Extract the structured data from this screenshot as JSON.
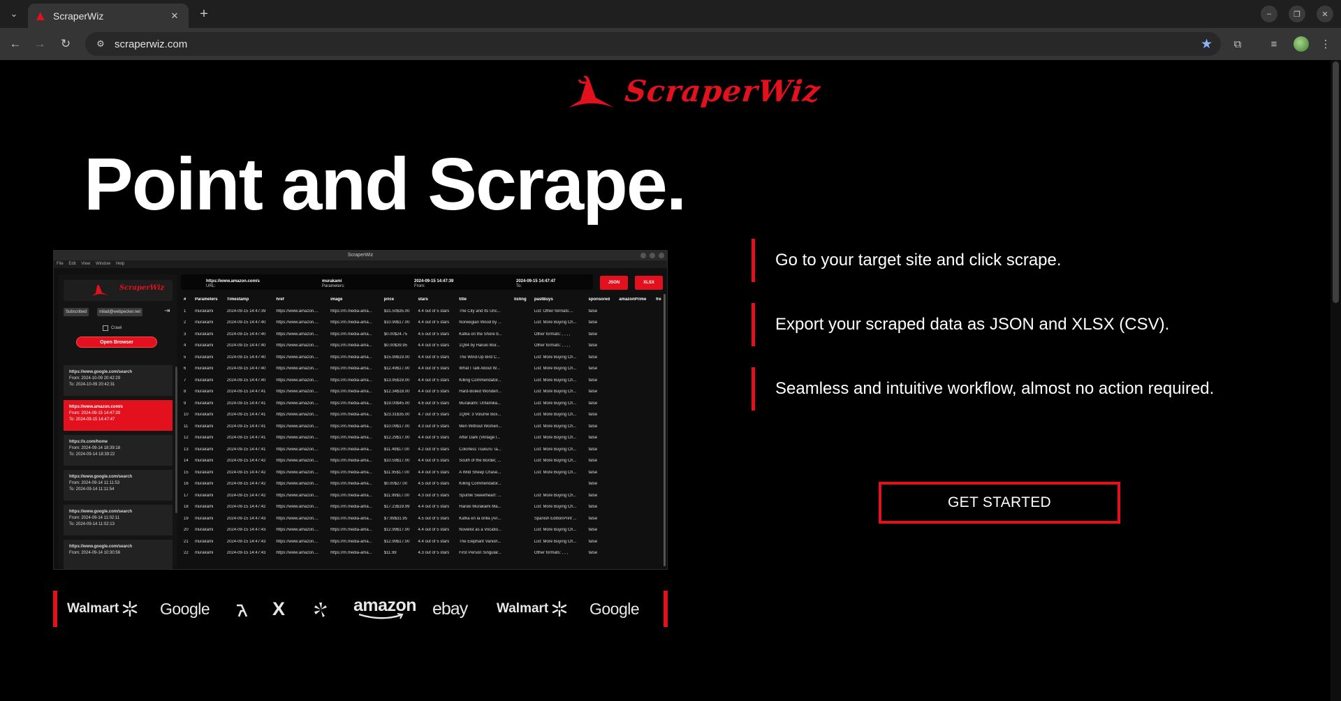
{
  "browser": {
    "tab_title": "ScraperWiz",
    "url": "scraperwiz.com"
  },
  "brand": {
    "name": "ScraperWiz"
  },
  "hero": {
    "title": "Point and Scrape."
  },
  "features": [
    {
      "text": "Go to your target site and click scrape."
    },
    {
      "text": "Export your scraped data as JSON and XLSX (CSV)."
    },
    {
      "text": "Seamless and intuitive workflow, almost no action required."
    }
  ],
  "cta": {
    "label": "GET STARTED"
  },
  "preview": {
    "window_title": "ScraperWiz",
    "menu": [
      "File",
      "Edit",
      "View",
      "Window",
      "Help"
    ],
    "logo_name": "ScraperWiz",
    "subscribed": "Subscribed",
    "email": "milad@webpecker.net",
    "crawl": "Crawl",
    "open_browser": "Open Browser",
    "history": [
      {
        "url": "https://www.google.com/search",
        "from": "From: 2024-10-09 20:42:29",
        "to": "To: 2024-10-09 20:42:31"
      },
      {
        "url": "https://www.amazon.com/s",
        "from": "From: 2024-09-15 14:47:39",
        "to": "To: 2024-09-15 14:47:47"
      },
      {
        "url": "https://x.com/home",
        "from": "From: 2024-09-14 18:39:18",
        "to": "To: 2024-09-14 18:39:22"
      },
      {
        "url": "https://www.google.com/search",
        "from": "From: 2024-09-14 11:11:53",
        "to": "To: 2024-09-14 11:11:54"
      },
      {
        "url": "https://www.google.com/search",
        "from": "From: 2024-09-14 11:02:11",
        "to": "To: 2024-09-14 11:02:13"
      },
      {
        "url": "https://www.google.com/search",
        "from": "From: 2024-09-14 10:30:56",
        "to": ""
      }
    ],
    "params": {
      "url_label": "URL:",
      "url": "https://www.amazon.com/s",
      "parameters_label": "Parameters:",
      "parameters": "murakami",
      "from_label": "From:",
      "from": "2024-09-15 14:47:39",
      "to_label": "To:",
      "to": "2024-09-15 14:47:47"
    },
    "json_button": "JSON",
    "xlsx_button": "XLSX",
    "columns": [
      "#",
      "Parameters",
      "Timestamp",
      "href",
      "image",
      "price",
      "stars",
      "title",
      "listing",
      "pastBuys",
      "sponsored",
      "amazonPrime",
      "fre"
    ],
    "rows": [
      [
        "1",
        "murakami",
        "2024-09-15 14:47:39",
        "https://www.amazon....",
        "https://m.media-ama...",
        "$31.50$35.00",
        "4.4 out of 5 stars",
        "The City and Its Unc...",
        "",
        "List: Other formats:...",
        "false",
        "",
        ""
      ],
      [
        "2",
        "murakami",
        "2024-09-15 14:47:40",
        "https://www.amazon....",
        "https://m.media-ama...",
        "$10.99$17.00",
        "4.4 out of 5 stars",
        "Norwegian Wood by ...",
        "",
        "List: More Buying Ch...",
        "false",
        "",
        ""
      ],
      [
        "3",
        "murakami",
        "2024-09-15 14:47:40",
        "https://www.amazon....",
        "https://m.media-ama...",
        "$0.00$24.75",
        "4.5 out of 5 stars",
        "Kafka on the Shore b...",
        "",
        "Other formats: , , , ,",
        "false",
        "",
        ""
      ],
      [
        "4",
        "murakami",
        "2024-09-15 14:47:40",
        "https://www.amazon....",
        "https://m.media-ama...",
        "$0.00$39.95",
        "4.4 out of 5 stars",
        "1Q84 by Haruki Mur...",
        "",
        "Other formats: , , , ,",
        "false",
        "",
        ""
      ],
      [
        "5",
        "murakami",
        "2024-09-15 14:47:40",
        "https://www.amazon....",
        "https://m.media-ama...",
        "$15.99$19.00",
        "4.4 out of 5 stars",
        "The Wind-Up Bird C...",
        "",
        "List: More Buying Ch...",
        "false",
        "",
        ""
      ],
      [
        "6",
        "murakami",
        "2024-09-15 14:47:40",
        "https://www.amazon....",
        "https://m.media-ama...",
        "$12.49$17.00",
        "4.4 out of 5 stars",
        "What I Talk About W...",
        "",
        "List: More Buying Ch...",
        "false",
        "",
        ""
      ],
      [
        "7",
        "murakami",
        "2024-09-15 14:47:40",
        "https://www.amazon....",
        "https://m.media-ama...",
        "$13.95$19.00",
        "4.4 out of 5 stars",
        "Killing Commendator...",
        "",
        "List: More Buying Ch...",
        "false",
        "",
        ""
      ],
      [
        "8",
        "murakami",
        "2024-09-15 14:47:41",
        "https://www.amazon....",
        "https://m.media-ama...",
        "$12.34$18.00",
        "4.4 out of 5 stars",
        "Hard-Boiled Wonderl...",
        "",
        "List: More Buying Ch...",
        "false",
        "",
        ""
      ],
      [
        "9",
        "murakami",
        "2024-09-15 14:47:41",
        "https://www.amazon....",
        "https://m.media-ama...",
        "$19.00$45.00",
        "4.6 out of 5 stars",
        "Murakami: Unfamilia...",
        "",
        "List: More Buying Ch...",
        "false",
        "",
        ""
      ],
      [
        "10",
        "murakami",
        "2024-09-15 14:47:41",
        "https://www.amazon....",
        "https://m.media-ama...",
        "$23.31$35.00",
        "4.7 out of 5 stars",
        "1Q84: 3 Volume Box...",
        "",
        "List: More Buying Ch...",
        "false",
        "",
        ""
      ],
      [
        "11",
        "murakami",
        "2024-09-15 14:47:41",
        "https://www.amazon....",
        "https://m.media-ama...",
        "$10.09$17.00",
        "4.3 out of 5 stars",
        "Men Without Women...",
        "",
        "List: More Buying Ch...",
        "false",
        "",
        ""
      ],
      [
        "12",
        "murakami",
        "2024-09-15 14:47:41",
        "https://www.amazon....",
        "https://m.media-ama...",
        "$12.29$17.00",
        "4.4 out of 5 stars",
        "After Dark (Vintage I...",
        "",
        "List: More Buying Ch...",
        "false",
        "",
        ""
      ],
      [
        "13",
        "murakami",
        "2024-09-15 14:47:41",
        "https://www.amazon....",
        "https://m.media-ama...",
        "$11.49$17.00",
        "4.2 out of 5 stars",
        "Colorless Tsukuru Ta...",
        "",
        "List: More Buying Ch...",
        "false",
        "",
        ""
      ],
      [
        "14",
        "murakami",
        "2024-09-15 14:47:42",
        "https://www.amazon....",
        "https://m.media-ama...",
        "$10.59$17.00",
        "4.4 out of 5 stars",
        "South of the Border, ...",
        "",
        "List: More Buying Ch...",
        "false",
        "",
        ""
      ],
      [
        "15",
        "murakami",
        "2024-09-15 14:47:42",
        "https://www.amazon....",
        "https://m.media-ama...",
        "$11.95$17.00",
        "4.4 out of 5 stars",
        "A Wild Sheep Chase...",
        "",
        "List: More Buying Ch...",
        "false",
        "",
        ""
      ],
      [
        "16",
        "murakami",
        "2024-09-15 14:47:42",
        "https://www.amazon....",
        "https://m.media-ama...",
        "$0.00$27.00",
        "4.5 out of 5 stars",
        "Killing Commendator...",
        "",
        "",
        "false",
        "",
        ""
      ],
      [
        "17",
        "murakami",
        "2024-09-15 14:47:42",
        "https://www.amazon....",
        "https://m.media-ama...",
        "$11.99$17.00",
        "4.3 out of 5 stars",
        "Sputnik Sweetheart: ...",
        "",
        "List: More Buying Ch...",
        "false",
        "",
        ""
      ],
      [
        "18",
        "murakami",
        "2024-09-15 14:47:42",
        "https://www.amazon....",
        "https://m.media-ama...",
        "$17.23$19.99",
        "4.4 out of 5 stars",
        "Haruki Murakami Ma...",
        "",
        "List: More Buying Ch...",
        "false",
        "",
        ""
      ],
      [
        "19",
        "murakami",
        "2024-09-15 14:47:43",
        "https://www.amazon....",
        "https://m.media-ama...",
        "$7.99$31.95",
        "4.5 out of 5 stars",
        "Kafka en la orilla (An...",
        "",
        "Spanish EditionPrint ...",
        "false",
        "",
        ""
      ],
      [
        "20",
        "murakami",
        "2024-09-15 14:47:43",
        "https://www.amazon....",
        "https://m.media-ama...",
        "$12.99$17.00",
        "4.4 out of 5 stars",
        "Novelist as a Vocatio...",
        "",
        "List: More Buying Ch...",
        "false",
        "",
        ""
      ],
      [
        "21",
        "murakami",
        "2024-09-15 14:47:43",
        "https://www.amazon....",
        "https://m.media-ama...",
        "$12.99$17.00",
        "4.4 out of 5 stars",
        "The Elephant Vanish...",
        "",
        "List: More Buying Ch...",
        "false",
        "",
        ""
      ],
      [
        "22",
        "murakami",
        "2024-09-15 14:47:43",
        "https://www.amazon....",
        "https://m.media-ama...",
        "$11.99",
        "4.3 out of 5 stars",
        "First Person Singular...",
        "",
        "Other formats: , , ,",
        "false",
        "",
        ""
      ]
    ]
  },
  "logos": [
    "Walmart",
    "Google",
    "X",
    "amazon",
    "ebay",
    "Walmart",
    "Google"
  ],
  "icons": {
    "tab_menu": "chevron-down-icon",
    "new_tab": "plus-icon",
    "back": "arrow-left-icon",
    "forward": "arrow-right-icon",
    "reload": "reload-icon",
    "bookmark": "star-icon"
  },
  "colors": {
    "accent": "#e3101d",
    "background": "#000000"
  }
}
